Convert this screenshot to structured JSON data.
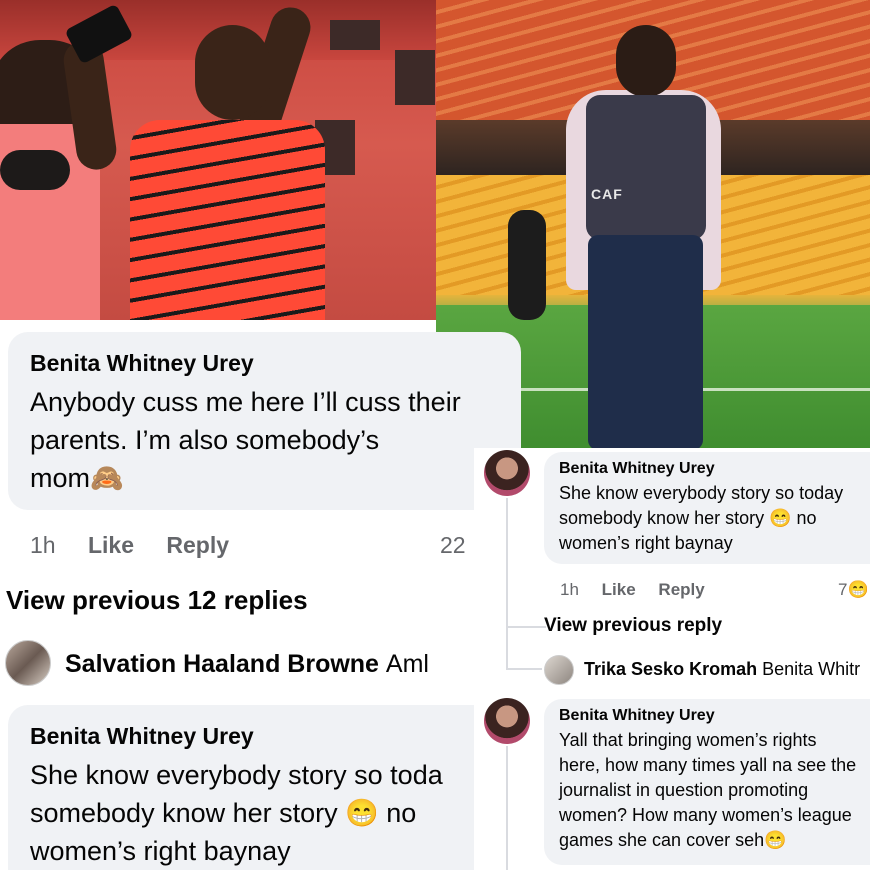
{
  "photos": {
    "left_alt": "",
    "right_vest_text": "CAF"
  },
  "comment_main": {
    "author": "Benita Whitney Urey",
    "text_line1": "Anybody cuss me here I’ll cuss their",
    "text_line2": "parents. I’m also somebody’s",
    "text_line3": "mom🙈",
    "time": "1h",
    "like_label": "Like",
    "reply_label": "Reply",
    "reaction_count": "22"
  },
  "view_previous": "View previous 12 replies",
  "reply_salvation": {
    "author": "Salvation Haaland Browne",
    "preview": "Aml"
  },
  "comment_bottom": {
    "author": "Benita Whitney Urey",
    "text_line1": "She know everybody story so toda",
    "text_line2": "somebody know her story 😁 no",
    "text_line3": "women’s right baynay"
  },
  "thread_right": {
    "reply1": {
      "author": "Benita Whitney Urey",
      "text_line1": "She know everybody story so today",
      "text_line2": "somebody know her story 😁 no",
      "text_line3": "women’s right baynay",
      "time": "1h",
      "like_label": "Like",
      "reply_label": "Reply",
      "reaction_count": "7😁"
    },
    "view_previous": "View previous reply",
    "trika": {
      "author": "Trika Sesko Kromah",
      "preview": "Benita Whitr"
    },
    "reply2": {
      "author": "Benita Whitney Urey",
      "text_line1": "Yall that bringing women’s rights",
      "text_line2": "here, how many times yall na see the",
      "text_line3": "journalist in question promoting",
      "text_line4": "women? How many women’s league",
      "text_line5": "games she can cover seh😁"
    }
  },
  "colors": {
    "bubble_bg": "#f0f2f5",
    "meta_text": "#65676b",
    "primary_text": "#050505"
  }
}
